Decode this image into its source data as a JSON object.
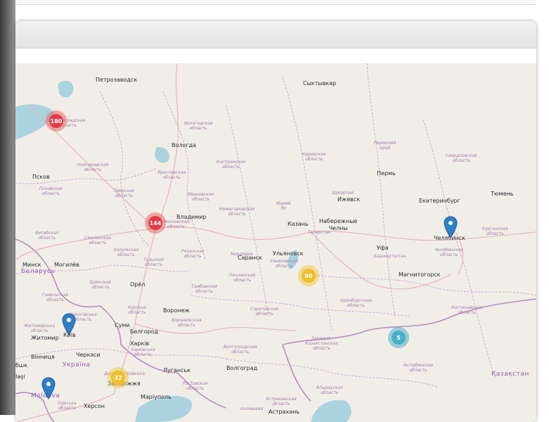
{
  "map": {
    "cities": {
      "petrozavodsk": "Петрозаводск",
      "syktyvkar": "Сыктывкар",
      "vologda": "Вологда",
      "pskov": "Псков",
      "perm": "Пермь",
      "tyumen": "Тюмень",
      "izhevsk": "Ижевск",
      "ekaterinburg": "Екатеринбург",
      "vladimir": "Владимир",
      "kazan": "Казань",
      "nab_chelny": "Набережные\nЧелны",
      "chelyabinsk": "Челябинск",
      "ufa": "Уфа",
      "ulyanovsk": "Ульяновск",
      "saransk": "Саранск",
      "minsk": "Минск",
      "mogilev": "Могилёв",
      "orel": "Орёл",
      "magnitogorsk": "Магнитогорск",
      "voronezh": "Воронеж",
      "sumy": "Суми",
      "belgorod": "Белгород",
      "kyiv": "Київ",
      "zhytomyr": "Житомир",
      "kharkiv": "Харків",
      "vinnytsia": "Вінниця",
      "cherkasy": "Черкаси",
      "luhansk": "Луганськ",
      "volgograd": "Волгоград",
      "zaporizhzhia": "Запоріжжя",
      "mariupol": "Маріуполь",
      "kherson": "Херсон",
      "astrakhan": "Астрахань",
      "bshk": "бшк",
      "iasi": "Iaşi"
    },
    "countries": {
      "belarus": "Беларусь",
      "ukraine": "Україна",
      "moldova": "Moldova",
      "kazakhstan": "Қазақстан"
    },
    "regions": {
      "vologda_obl": "Вологодская\nобласть",
      "novgorod_obl": "Новгородская\nобласть",
      "pskov_obl": "Псковская\nобласть",
      "tver_obl": "Тверская\nобласть",
      "yaroslavl_obl": "Ярославская\nобласть",
      "kostroma_obl": "Костромская\nобласть",
      "ivanovo_obl": "Ивановская\nобласть",
      "kirov_obl": "Кировская\nобласть",
      "perm_krai": "Пермский\nкрай",
      "sverdlovsk_obl": "Свердловская\nобласть",
      "udmurtia": "Удмуртия",
      "mariy_el": "Марий\nЭл",
      "nizhny_obl": "Нижегородская\nобласть",
      "tatarstan": "Татарстан",
      "kurgan_obl": "Курганская\nобласть",
      "chelyabinsk_obl": "Челябинская\nобласть",
      "bashkortostan": "Башкортостан",
      "vitebsk_obl": "Витебская\nобласть",
      "smolensk_obl": "Смоленская\nобласть",
      "kaluga_obl": "Калужская\nобласть",
      "tula_obl": "Тульская\nобласть",
      "ryazan_obl": "Рязанская\nобласть",
      "mordovia": "Мордовия",
      "ulyanovsk_obl": "Ульяновская\nобласть",
      "penza_obl": "Пензенская\nобласть",
      "bryansk_obl": "Брянская\nобласть",
      "tambov_obl": "Тамбовская\nобласть",
      "gomel_obl": "Гомельская\nобласть",
      "kursk_obl": "Курская\nобласть",
      "voronezh_obl": "Воронежская\nобласть",
      "saratov_obl": "Саратовская\nобласть",
      "orenburg_obl": "Оренбургская\nобласть",
      "kostanay_obl": "Костанайская\nобласть",
      "zhytomyr_obl": "Житомирська\nобласть",
      "chernihiv_obl": "Чернігівська\nобласть",
      "kharkiv_obl": "Харківська\nобласть",
      "west_kz_obl": "Западно-\nКазахстанская\nобласть",
      "aktobe_obl": "Актюбинская\nобласть",
      "volgograd_obl": "Волгоградская\nобласть",
      "rostov_obl": "Ростовская\nобласть",
      "dnipro_obl": "Дніпропетровська",
      "atyrau_obl": "Атырауская\nобласть",
      "astrakhan_obl": "Астраханская\nобласть",
      "kalmykia": "Калмыкия",
      "odesa_obl": "Одеська\nобласть",
      "moscow_obl": "Московская\nобласть",
      "leningrad_obl": "Ленинградская\nобласть"
    },
    "clusters": [
      {
        "id": "cluster-180",
        "label": "180",
        "color": "#e03c48"
      },
      {
        "id": "cluster-144",
        "label": "144",
        "color": "#e03c48"
      },
      {
        "id": "cluster-90",
        "label": "90",
        "color": "#f0bf2a"
      },
      {
        "id": "cluster-32",
        "label": "32",
        "color": "#f0bf2a"
      },
      {
        "id": "cluster-5",
        "label": "5",
        "color": "#45b2cc"
      }
    ],
    "markers": [
      {
        "id": "marker-chelyabinsk",
        "color": "#2f7fc8"
      },
      {
        "id": "marker-kyiv",
        "color": "#2f7fc8"
      },
      {
        "id": "marker-moldova",
        "color": "#2f7fc8"
      }
    ],
    "colors": {
      "land": "#f1eee8",
      "water": "#aad3df",
      "boundary": "#c8a8cf",
      "road": "#e8b4b8"
    }
  }
}
